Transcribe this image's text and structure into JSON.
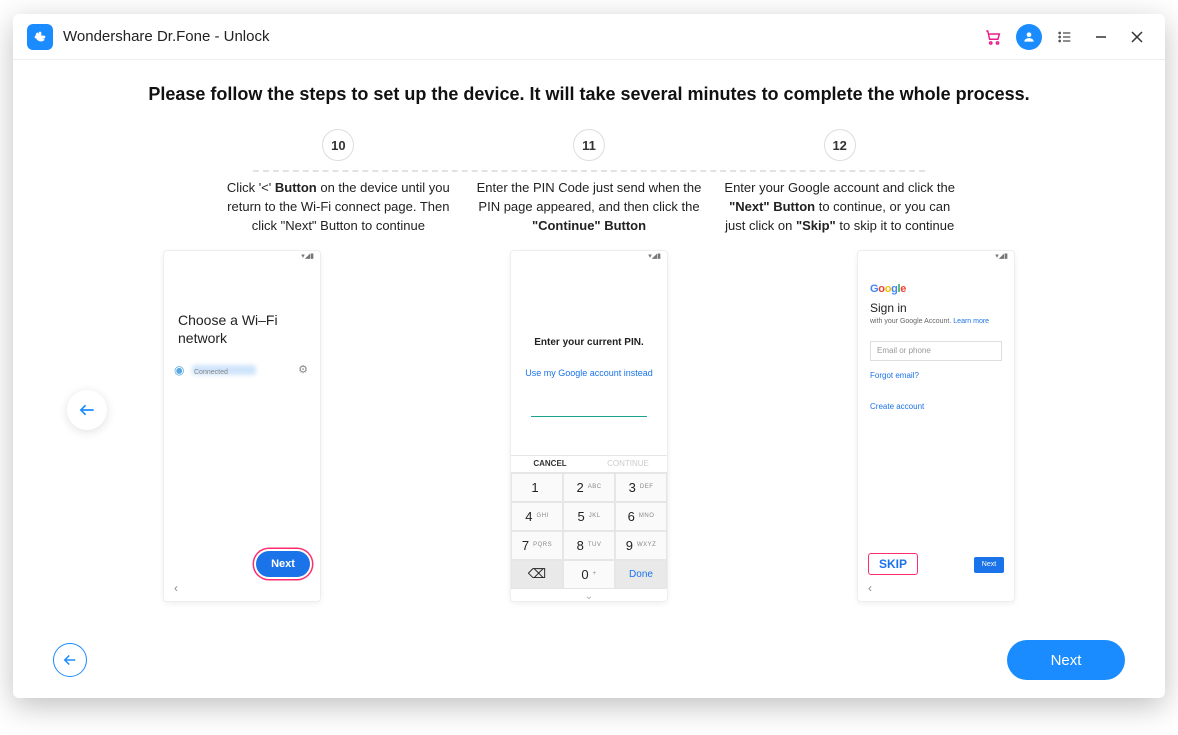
{
  "app": {
    "title": "Wondershare Dr.Fone - Unlock"
  },
  "heading": "Please follow the steps to set up the device. It will take several minutes to complete the whole process.",
  "steps": [
    {
      "num": "10",
      "desc_pre": "Click '<' ",
      "desc_bold": "Button",
      "desc_post": " on the device until you return to the Wi-Fi connect page. Then click \"Next\" Button to continue"
    },
    {
      "num": "11",
      "desc_pre": "Enter the PIN Code just send when the PIN page appeared, and then click the ",
      "desc_bold": "\"Continue\" Button",
      "desc_post": ""
    },
    {
      "num": "12",
      "desc_pre": "Enter your Google account and click the ",
      "desc_bold": "\"Next\" Button",
      "desc_mid": " to continue, or you can just click on ",
      "desc_bold2": "\"Skip\"",
      "desc_post": " to skip it to continue"
    }
  ],
  "phone1": {
    "choose": "Choose a Wi–Fi network",
    "connected": "Connected",
    "next": "Next"
  },
  "phone2": {
    "title": "Enter your current PIN.",
    "link": "Use my Google account instead",
    "cancel": "CANCEL",
    "cont": "CONTINUE",
    "keys": [
      {
        "n": "1",
        "l": ""
      },
      {
        "n": "2",
        "l": "ABC"
      },
      {
        "n": "3",
        "l": "DEF"
      },
      {
        "n": "4",
        "l": "GHI"
      },
      {
        "n": "5",
        "l": "JKL"
      },
      {
        "n": "6",
        "l": "MNO"
      },
      {
        "n": "7",
        "l": "PQRS"
      },
      {
        "n": "8",
        "l": "TUV"
      },
      {
        "n": "9",
        "l": "WXYZ"
      }
    ],
    "done": "Done"
  },
  "phone3": {
    "signin": "Sign in",
    "sub": "with your Google Account.",
    "learn": "Learn more",
    "placeholder": "Email or phone",
    "forgot": "Forgot email?",
    "create": "Create account",
    "skip": "SKIP",
    "next": "Next"
  },
  "footer": {
    "next": "Next"
  }
}
